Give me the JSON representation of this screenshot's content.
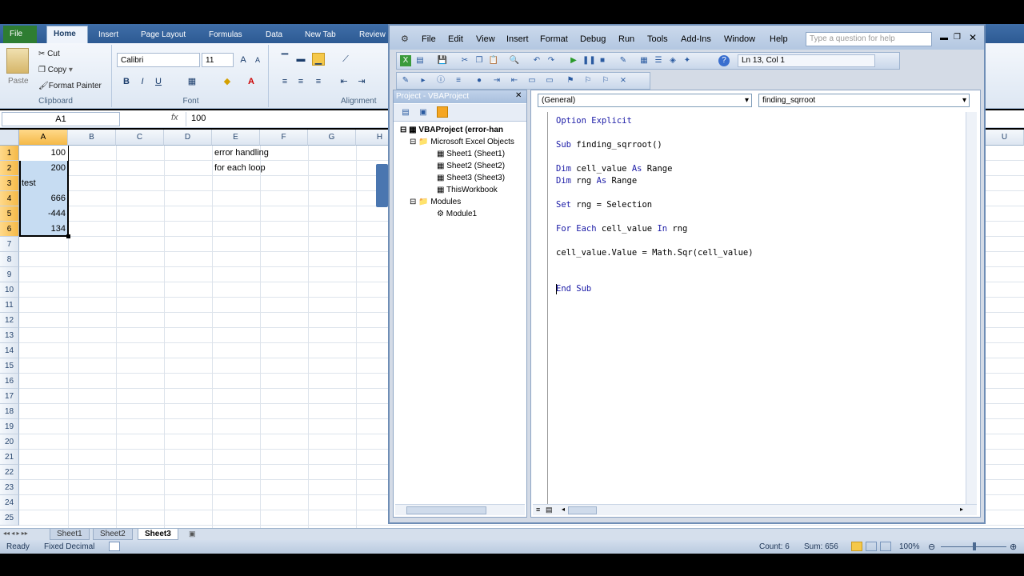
{
  "excel": {
    "tabs": [
      "File",
      "Home",
      "Insert",
      "Page Layout",
      "Formulas",
      "Data",
      "New Tab",
      "Review"
    ],
    "clipboard": {
      "paste": "Paste",
      "cut": "Cut",
      "copy": "Copy",
      "format_painter": "Format Painter",
      "group": "Clipboard"
    },
    "font": {
      "name": "Calibri",
      "size": "11",
      "group": "Font"
    },
    "alignment_group": "Alignment",
    "name_box": "A1",
    "fx": "fx",
    "formula_value": "100",
    "columns": [
      "A",
      "B",
      "C",
      "D",
      "E",
      "F",
      "G",
      "H"
    ],
    "right_columns": [
      "U"
    ],
    "rows": [
      "1",
      "2",
      "3",
      "4",
      "5",
      "6",
      "7",
      "8",
      "9",
      "10",
      "11",
      "12",
      "13",
      "14",
      "15",
      "16",
      "17",
      "18",
      "19",
      "20",
      "21",
      "22",
      "23",
      "24",
      "25"
    ],
    "cells": {
      "a1": "100",
      "a2": "200",
      "a3": "test",
      "a4": "666",
      "a5": "-444",
      "a6": "134",
      "e1": "error handling",
      "e2": "for each loop"
    },
    "sheets": [
      "Sheet1",
      "Sheet2",
      "Sheet3"
    ],
    "status": {
      "ready": "Ready",
      "fixed_decimal": "Fixed Decimal",
      "count": "Count: 6",
      "sum": "Sum: 656",
      "zoom": "100%"
    }
  },
  "vba": {
    "menu": [
      "File",
      "Edit",
      "View",
      "Insert",
      "Format",
      "Debug",
      "Run",
      "Tools",
      "Add-Ins",
      "Window",
      "Help"
    ],
    "help_placeholder": "Type a question for help",
    "position": "Ln 13, Col 1",
    "project": {
      "title": "Project - VBAProject",
      "root": "VBAProject (error-han",
      "excel_objects": "Microsoft Excel Objects",
      "sheets": [
        "Sheet1 (Sheet1)",
        "Sheet2 (Sheet2)",
        "Sheet3 (Sheet3)"
      ],
      "workbook": "ThisWorkbook",
      "modules": "Modules",
      "module1": "Module1"
    },
    "object_dropdown": "(General)",
    "proc_dropdown": "finding_sqrroot",
    "code": [
      "Option Explicit",
      "",
      "Sub finding_sqrroot()",
      "",
      "Dim cell_value As Range",
      "Dim rng As Range",
      "",
      "Set rng = Selection",
      "",
      "For Each cell_value In rng",
      "",
      "cell_value.Value = Math.Sqr(cell_value)",
      "",
      "",
      "End Sub"
    ]
  },
  "colors": {
    "selection": "#f5b947",
    "vba_keyword": "#1a1aa6",
    "ribbon_blue": "#2d5a93"
  }
}
